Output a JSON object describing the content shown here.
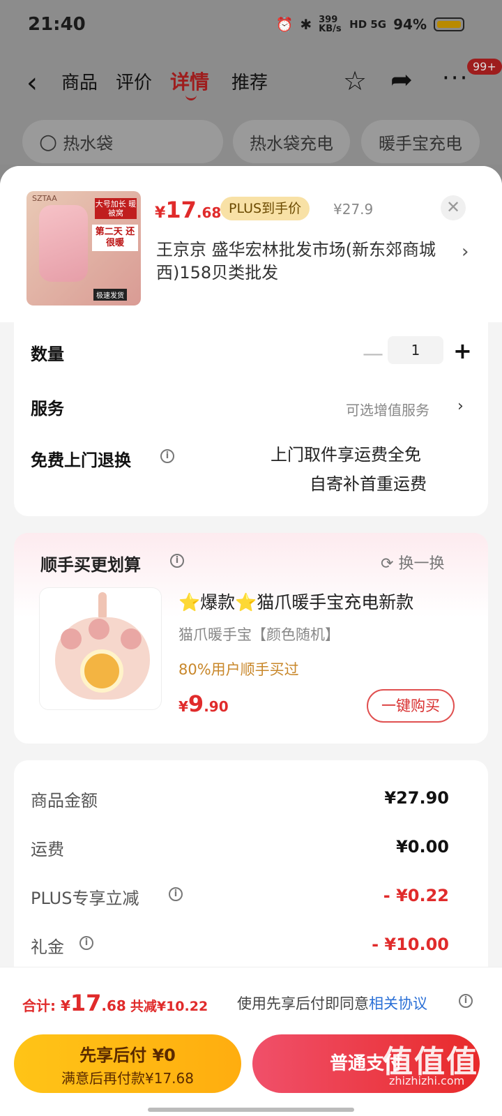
{
  "status_bar": {
    "time": "21:40",
    "net_speed": "399 KB/s",
    "signal": "HD 5G",
    "battery": "94%"
  },
  "header": {
    "tabs": [
      "商品",
      "评价",
      "详情",
      "推荐"
    ],
    "active_tab": "详情",
    "badge": "99+",
    "search_placeholder": "热水袋",
    "chips": [
      "热水袋充电",
      "暖手宝充电"
    ]
  },
  "product": {
    "image_brand": "SZTAA",
    "image_tag1": "大号加长 暖被窝",
    "image_tag2": "第二天 还很暖",
    "image_tag3": "极速发货",
    "price_currency": "¥",
    "price_int": "17",
    "price_dec": ".68",
    "plus_tag": "PLUS到手价",
    "original_price": "¥27.9",
    "address": "王京京  盛华宏林批发市场(新东郊商城西)158贝类批发"
  },
  "options": {
    "quantity_label": "数量",
    "quantity_value": "1",
    "service_label": "服务",
    "service_value": "可选增值服务",
    "return_label": "免费上门退换",
    "return_value_1": "上门取件享运费全免",
    "return_value_2": "自寄补首重运费"
  },
  "recommend": {
    "title": "顺手买更划算",
    "refresh": "换一换",
    "name": "⭐爆款⭐猫爪暖手宝充电新款",
    "spec": "猫爪暖手宝【颜色随机】",
    "sold": "80%用户顺手买过",
    "price_currency": "¥",
    "price_int": "9",
    "price_dec": ".90",
    "buy_button": "一键购买"
  },
  "summary": {
    "rows": [
      {
        "label": "商品金额",
        "value": "¥27.90"
      },
      {
        "label": "运费",
        "value": "¥0.00"
      },
      {
        "label": "PLUS专享立减",
        "value": "- ¥0.22"
      },
      {
        "label": "礼金",
        "value": "- ¥10.00"
      }
    ]
  },
  "bottom": {
    "total_label": "合计: ",
    "total_currency": "¥",
    "total_int": "17",
    "total_dec": ".68",
    "saved": "共减¥10.22",
    "agree_text": "使用先享后付即同意",
    "agree_link": "相关协议",
    "later_title": "先享后付 ¥0",
    "later_sub": "满意后再付款¥17.68",
    "pay_button": "普通支付"
  },
  "watermark": {
    "text": "值值值",
    "url": "zhizhizhi.com"
  },
  "colors": {
    "accent_red": "#e02b2b",
    "pay_later_yellow": "#ffc417",
    "plus_gold": "#f8e1a6"
  }
}
